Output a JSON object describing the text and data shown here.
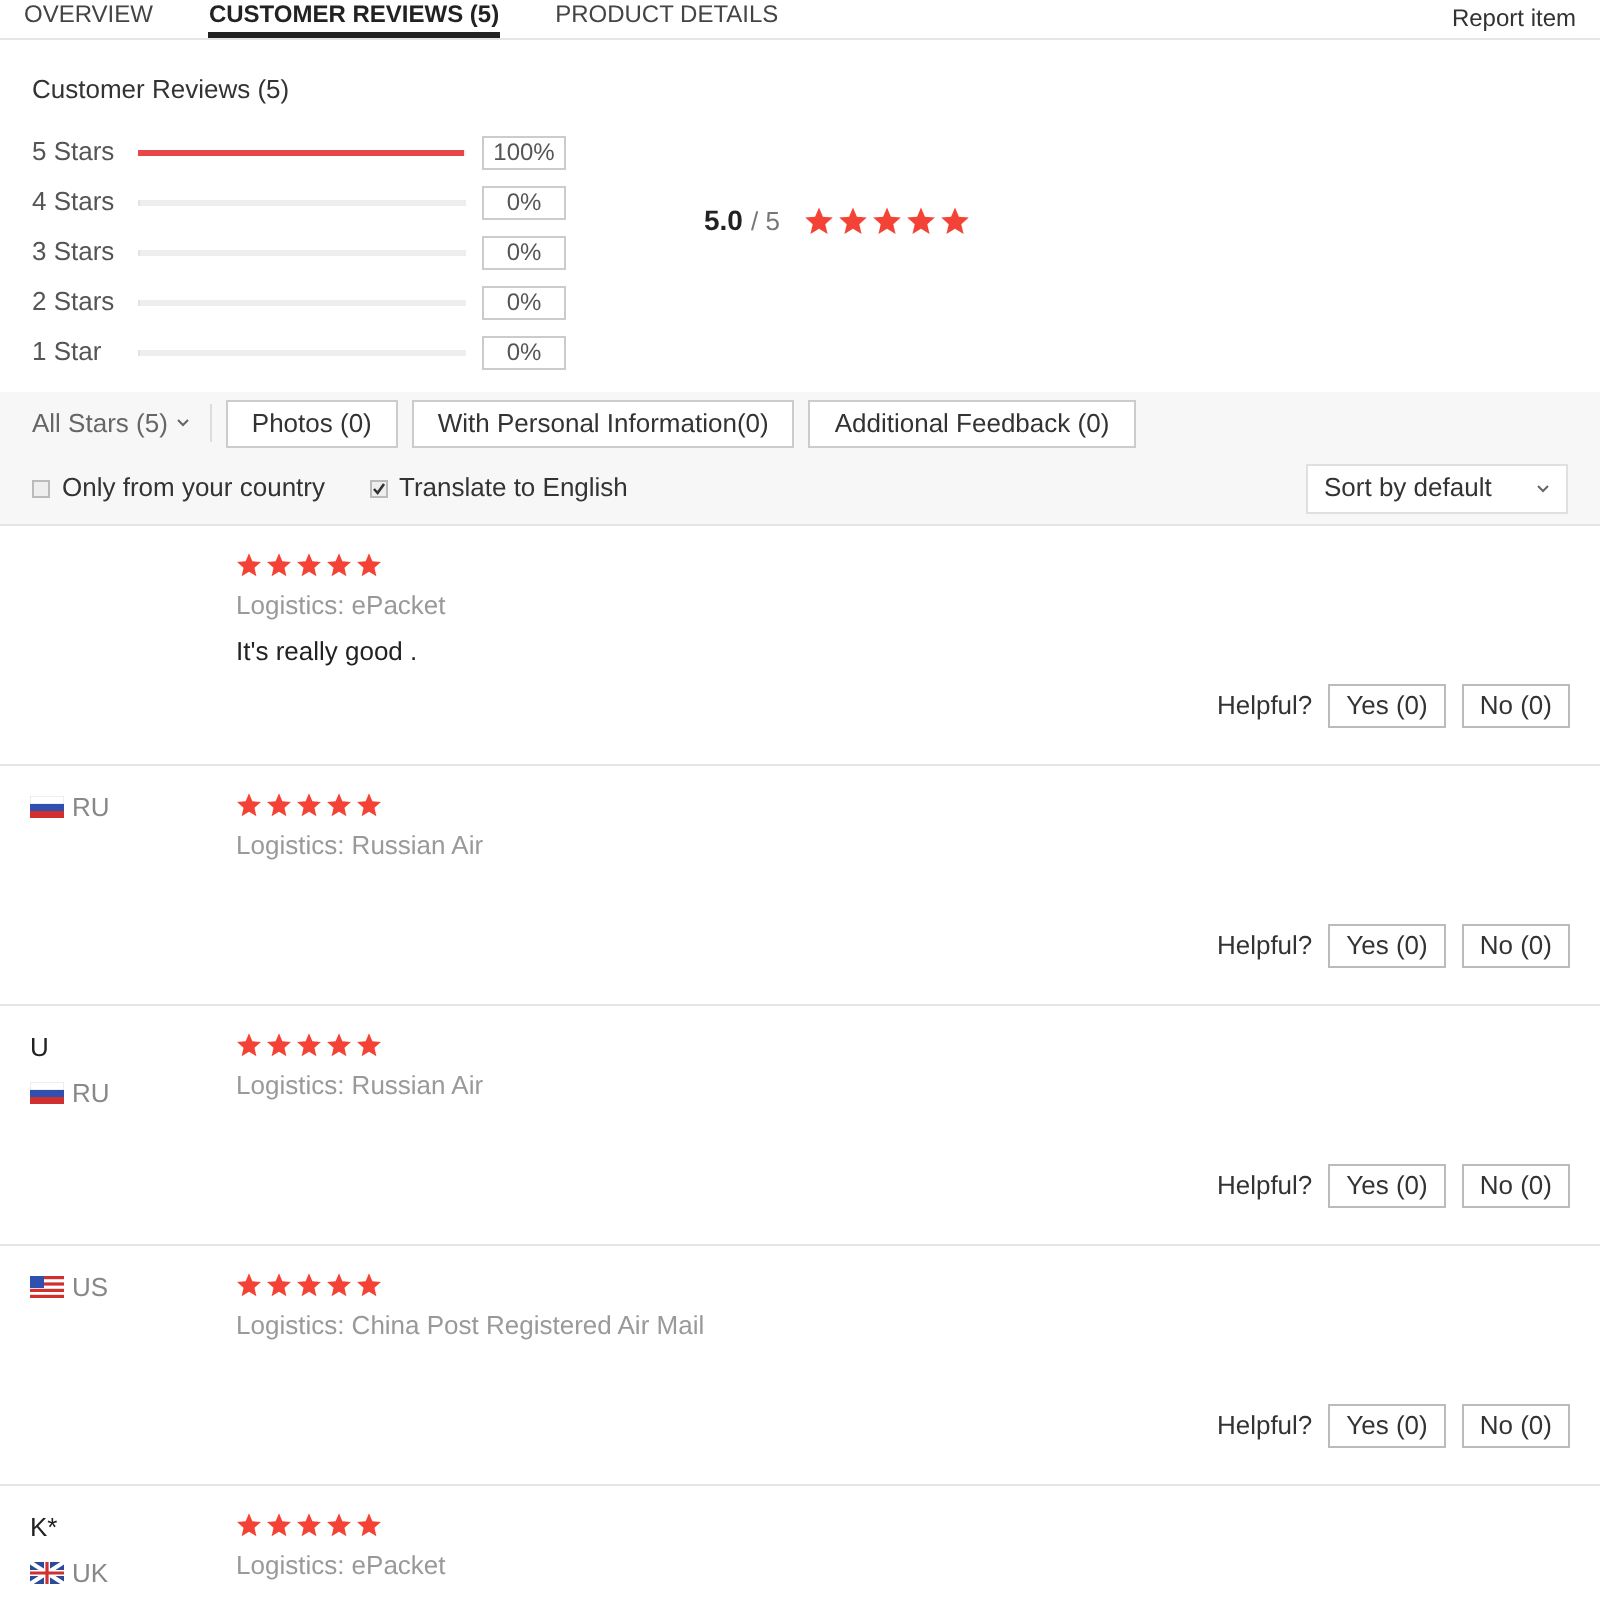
{
  "tabs": [
    {
      "label": "OVERVIEW",
      "selected": false
    },
    {
      "label": "CUSTOMER REVIEWS (5)",
      "selected": true
    },
    {
      "label": "PRODUCT DETAILS",
      "selected": false
    }
  ],
  "report_link": "Report item",
  "summary": {
    "title": "Customer Reviews (5)",
    "score": "5.0",
    "out_of": "/ 5",
    "stars": 5,
    "breakdown": [
      {
        "label": "5 Stars",
        "level": 1,
        "percent": "100%"
      },
      {
        "label": "4 Stars",
        "level": 0,
        "percent": "0%"
      },
      {
        "label": "3 Stars",
        "level": 0,
        "percent": "0%"
      },
      {
        "label": "2 Stars",
        "level": 0,
        "percent": "0%"
      },
      {
        "label": "1 Star",
        "level": 0,
        "percent": "0%"
      }
    ]
  },
  "filters": {
    "star_filter": "All Stars (5)",
    "buttons": [
      "Photos (0)",
      "With Personal Information(0)",
      "Additional Feedback (0)"
    ],
    "checkboxes": [
      {
        "label": "Only from your country",
        "checked": false
      },
      {
        "label": "Translate to English",
        "checked": true
      }
    ],
    "sort": "Sort by default"
  },
  "reviews": [
    {
      "stars": 5,
      "logistics": "Logistics: ePacket",
      "text": "It's really good .",
      "helpful": {
        "label": "Helpful?",
        "yes": "Yes (0)",
        "no": "No (0)"
      }
    },
    {
      "country": {
        "code": "RU",
        "kind": "ru"
      },
      "stars": 5,
      "logistics": "Logistics: Russian Air",
      "helpful": {
        "label": "Helpful?",
        "yes": "Yes (0)",
        "no": "No (0)"
      }
    },
    {
      "name": "U",
      "country": {
        "code": "RU",
        "kind": "ru"
      },
      "stars": 5,
      "logistics": "Logistics: Russian Air",
      "helpful": {
        "label": "Helpful?",
        "yes": "Yes (0)",
        "no": "No (0)"
      }
    },
    {
      "country": {
        "code": "US",
        "kind": "us"
      },
      "stars": 5,
      "logistics": "Logistics: China Post Registered Air Mail",
      "helpful": {
        "label": "Helpful?",
        "yes": "Yes (0)",
        "no": "No (0)"
      }
    },
    {
      "name": "K*",
      "country": {
        "code": "UK",
        "kind": "uk"
      },
      "stars": 5,
      "logistics": "Logistics: ePacket"
    }
  ]
}
